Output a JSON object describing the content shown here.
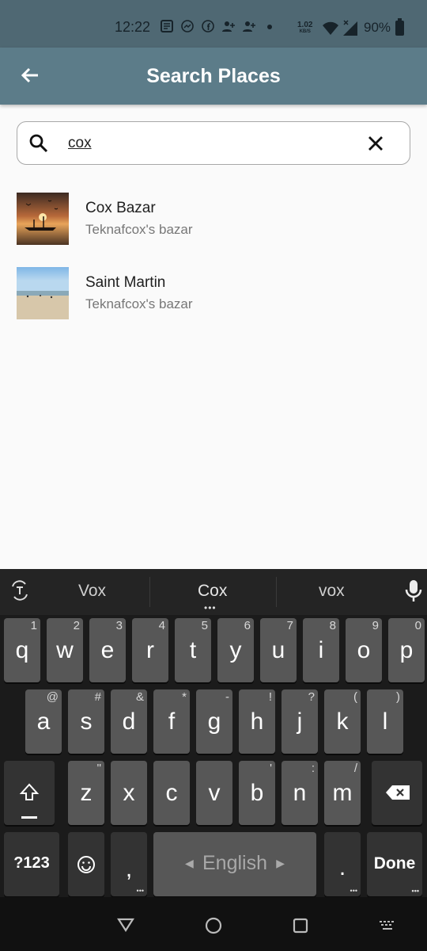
{
  "status_bar": {
    "time": "12:22",
    "speed_value": "1.02",
    "speed_unit": "KB/S",
    "battery": "90%",
    "icons": [
      "notes-icon",
      "messenger-icon",
      "facebook-icon",
      "person-add-icon",
      "person-add-icon",
      "dot-icon"
    ]
  },
  "appbar": {
    "title": "Search Places",
    "back_icon": "arrow-back-icon"
  },
  "search": {
    "value": "cox",
    "search_icon": "search-icon",
    "clear_icon": "close-icon"
  },
  "results": [
    {
      "title": "Cox Bazar",
      "subtitle": "Teknafcox's bazar",
      "image": "sunset-boat"
    },
    {
      "title": "Saint Martin",
      "subtitle": "Teknafcox's bazar",
      "image": "beach"
    }
  ],
  "keyboard": {
    "suggestions": [
      "Vox",
      "Cox",
      "vox"
    ],
    "row1": [
      {
        "k": "q",
        "h": "1"
      },
      {
        "k": "w",
        "h": "2"
      },
      {
        "k": "e",
        "h": "3"
      },
      {
        "k": "r",
        "h": "4"
      },
      {
        "k": "t",
        "h": "5"
      },
      {
        "k": "y",
        "h": "6"
      },
      {
        "k": "u",
        "h": "7"
      },
      {
        "k": "i",
        "h": "8"
      },
      {
        "k": "o",
        "h": "9"
      },
      {
        "k": "p",
        "h": "0"
      }
    ],
    "row2": [
      {
        "k": "a",
        "h": "@"
      },
      {
        "k": "s",
        "h": "#"
      },
      {
        "k": "d",
        "h": "&"
      },
      {
        "k": "f",
        "h": "*"
      },
      {
        "k": "g",
        "h": "-"
      },
      {
        "k": "h",
        "h": "!"
      },
      {
        "k": "j",
        "h": "?"
      },
      {
        "k": "k",
        "h": "("
      },
      {
        "k": "l",
        "h": ")"
      }
    ],
    "row3": [
      {
        "k": "z",
        "h": "\""
      },
      {
        "k": "x",
        "h": ""
      },
      {
        "k": "c",
        "h": ""
      },
      {
        "k": "v",
        "h": ""
      },
      {
        "k": "b",
        "h": "'"
      },
      {
        "k": "n",
        "h": ":"
      },
      {
        "k": "m",
        "h": "/"
      }
    ],
    "symbols_label": "?123",
    "comma_label": ",",
    "space_label": "English",
    "period_label": ".",
    "done_label": "Done"
  }
}
